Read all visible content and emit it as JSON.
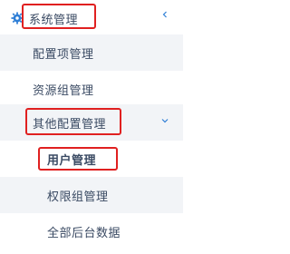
{
  "menu": {
    "system": {
      "label": "系统管理",
      "icon": "gear-icon",
      "toggle_icon": "chevron-left-icon"
    },
    "items": [
      {
        "label": "配置项管理"
      },
      {
        "label": "资源组管理"
      }
    ],
    "other_config": {
      "label": "其他配置管理",
      "toggle_icon": "chevron-down-icon",
      "children": [
        {
          "label": "用户管理"
        },
        {
          "label": "权限组管理"
        },
        {
          "label": "全部后台数据"
        }
      ]
    }
  },
  "colors": {
    "text": "#3a4a63",
    "icon": "#2f7fd6",
    "highlight_border": "#e02020",
    "alt_row_bg": "#f2f4f7"
  }
}
